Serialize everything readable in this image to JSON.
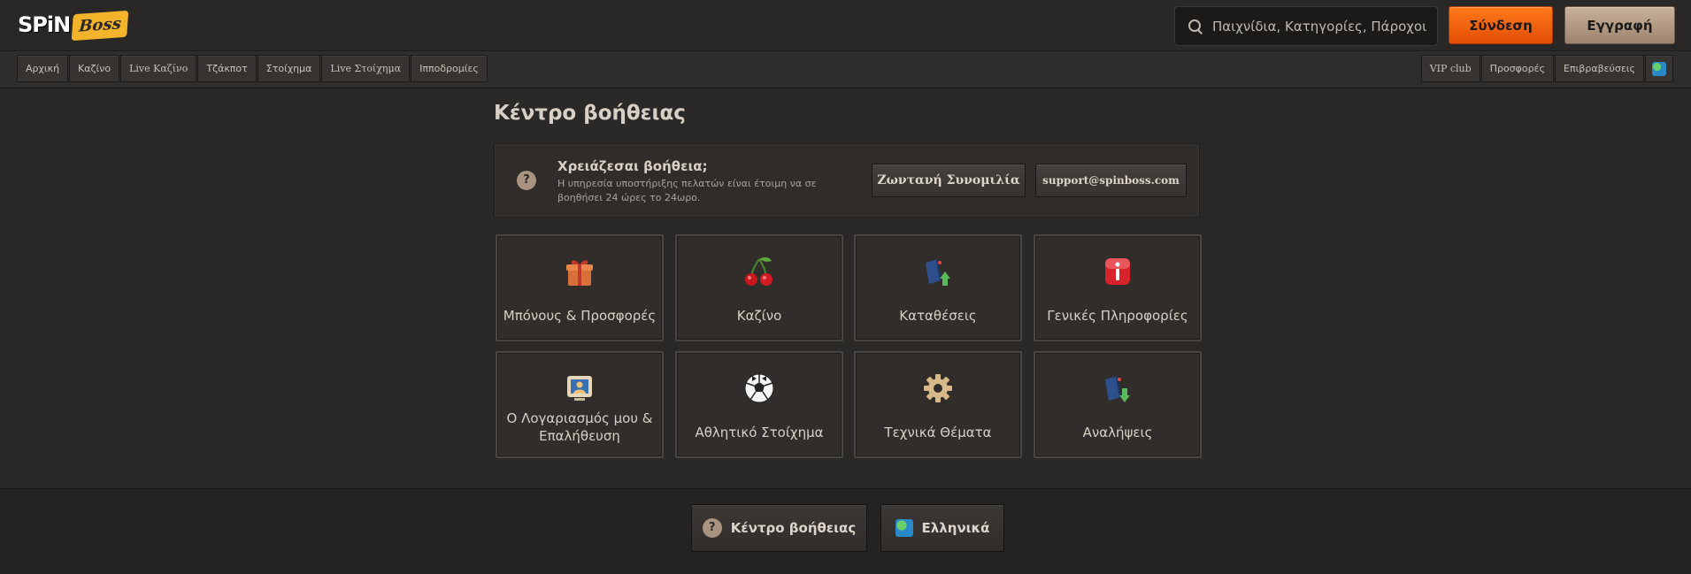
{
  "header": {
    "logo_spin": "SPiN",
    "logo_boss": "Boss",
    "search_placeholder": "Παιχνίδια, Κατηγορίες, Πάροχοι",
    "login_label": "Σύνδεση",
    "register_label": "Εγγραφή"
  },
  "nav": {
    "left": [
      {
        "label": "Αρχική"
      },
      {
        "label": "Καζίνο"
      },
      {
        "label": "Live Καζίνο"
      },
      {
        "label": "Τζάκποτ"
      },
      {
        "label": "Στοίχημα"
      },
      {
        "label": "Live Στοίχημα"
      },
      {
        "label": "Ιπποδρομίες"
      }
    ],
    "right": [
      {
        "label": "VIP club"
      },
      {
        "label": "Προσφορές"
      },
      {
        "label": "Επιβραβεύσεις"
      }
    ]
  },
  "main": {
    "title": "Κέντρο βοήθειας",
    "help": {
      "icon": "?",
      "title": "Χρειάζεσαι βοήθεια;",
      "desc": "Η υπηρεσία υποστήριξης πελατών είναι έτοιμη να σε βοηθήσει 24 ώρες το 24ωρο.",
      "live_chat_label": "Ζωντανή Συνομιλία",
      "email_label": "support@spinboss.com"
    },
    "tiles": [
      {
        "label": "Μπόνους & Προσφορές",
        "icon": "gift-icon"
      },
      {
        "label": "Καζίνο",
        "icon": "cherries-icon"
      },
      {
        "label": "Καταθέσεις",
        "icon": "deposit-icon"
      },
      {
        "label": "Γενικές Πληροφορίες",
        "icon": "info-icon"
      },
      {
        "label": "Ο Λογαριασμός μου & Επαλήθευση",
        "icon": "account-icon"
      },
      {
        "label": "Αθλητικό Στοίχημα",
        "icon": "football-icon"
      },
      {
        "label": "Τεχνικά Θέματα",
        "icon": "gear-icon"
      },
      {
        "label": "Αναλήψεις",
        "icon": "withdrawal-icon"
      }
    ]
  },
  "footer": {
    "help_label": "Κέντρο βοήθειας",
    "language_label": "Ελληνικά"
  },
  "colors": {
    "background": "#2b2928",
    "accent_login": "#f26a12",
    "register": "#b59b84"
  }
}
